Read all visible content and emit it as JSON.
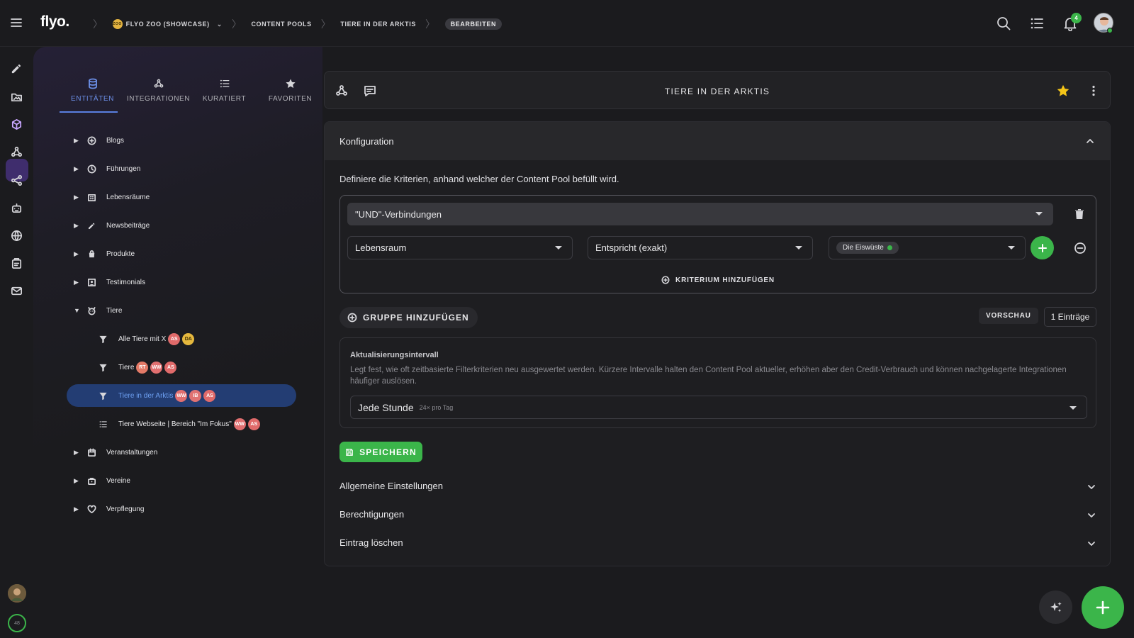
{
  "topbar": {
    "logo": "flyo.",
    "breadcrumbs": [
      {
        "label": "FLYO ZOO (SHOWCASE)",
        "badge": "ZOO"
      },
      {
        "label": "CONTENT POOLS"
      },
      {
        "label": "TIERE IN DER ARKTIS"
      },
      {
        "label": "BEARBEITEN"
      }
    ],
    "notification_count": "4",
    "icons": [
      "menu-icon",
      "search-icon",
      "list-icon",
      "bell-icon",
      "avatar"
    ]
  },
  "rail": {
    "items": [
      "edit-icon",
      "folder-icon",
      "cube-icon",
      "webhook-icon",
      "share-icon",
      "robot-icon",
      "globe-icon",
      "clipboard-icon",
      "mail-icon"
    ],
    "active_index": 2,
    "credits": "48"
  },
  "leftpanel": {
    "tabs": [
      {
        "label": "ENTITÄTEN",
        "icon": "database-icon",
        "active": true
      },
      {
        "label": "INTEGRATIONEN",
        "icon": "webhook-icon"
      },
      {
        "label": "KURATIERT",
        "icon": "list-icon"
      },
      {
        "label": "FAVORITEN",
        "icon": "star-icon"
      }
    ],
    "tree": [
      {
        "label": "Blogs",
        "icon": "plus-circle-icon"
      },
      {
        "label": "Führungen",
        "icon": "clock-icon"
      },
      {
        "label": "Lebensräume",
        "icon": "building-icon"
      },
      {
        "label": "Newsbeiträge",
        "icon": "pencil-icon"
      },
      {
        "label": "Produkte",
        "icon": "bag-icon"
      },
      {
        "label": "Testimonials",
        "icon": "portrait-icon"
      },
      {
        "label": "Tiere",
        "icon": "animal-icon",
        "expanded": true
      },
      {
        "label": "Veranstaltungen",
        "icon": "calendar-icon"
      },
      {
        "label": "Vereine",
        "icon": "briefcase-icon"
      },
      {
        "label": "Verpflegung",
        "icon": "heart-icon"
      }
    ],
    "tiere_children": [
      {
        "label": "Alle Tiere mit X",
        "icon": "filter-icon",
        "avatars": [
          "AS",
          "DA"
        ]
      },
      {
        "label": "Tiere",
        "icon": "filter-icon",
        "avatars": [
          "RT",
          "WW",
          "AS"
        ]
      },
      {
        "label": "Tiere in der Arktis",
        "icon": "filter-icon",
        "avatars": [
          "WW",
          "IB",
          "AS"
        ],
        "selected": true
      },
      {
        "label": "Tiere Webseite | Bereich \"Im Fokus\"",
        "icon": "list-icon",
        "avatars": [
          "WW",
          "AS"
        ]
      }
    ]
  },
  "header": {
    "title": "TIERE IN DER ARKTIS",
    "favorite": true
  },
  "config": {
    "title": "Konfiguration",
    "description": "Definiere die Kriterien, anhand welcher der Content Pool befüllt wird.",
    "group_operator": "\"UND\"-Verbindungen",
    "criterion": {
      "field": "Lebensraum",
      "operator": "Entspricht (exakt)",
      "value_chip": "Die Eiswüste"
    },
    "add_criterion": "KRITERIUM HINZUFÜGEN",
    "add_group": "GRUPPE HINZUFÜGEN",
    "preview": "VORSCHAU",
    "entries": "1 Einträge",
    "interval": {
      "title": "Aktualisierungsintervall",
      "description": "Legt fest, wie oft zeitbasierte Filterkriterien neu ausgewertet werden. Kürzere Intervalle halten den Content Pool aktueller, erhöhen aber den Credit-Verbrauch und können nachgelagerte Integrationen häufiger auslösen.",
      "value": "Jede Stunde",
      "value_sub": "24× pro Tag"
    },
    "save": "SPEICHERN"
  },
  "accordions": [
    "Allgemeine Einstellungen",
    "Berechtigungen",
    "Eintrag löschen"
  ],
  "colors": {
    "accent_green": "#3bb54a",
    "accent_blue": "#5a7fe0",
    "selected_bg": "#233d73"
  }
}
